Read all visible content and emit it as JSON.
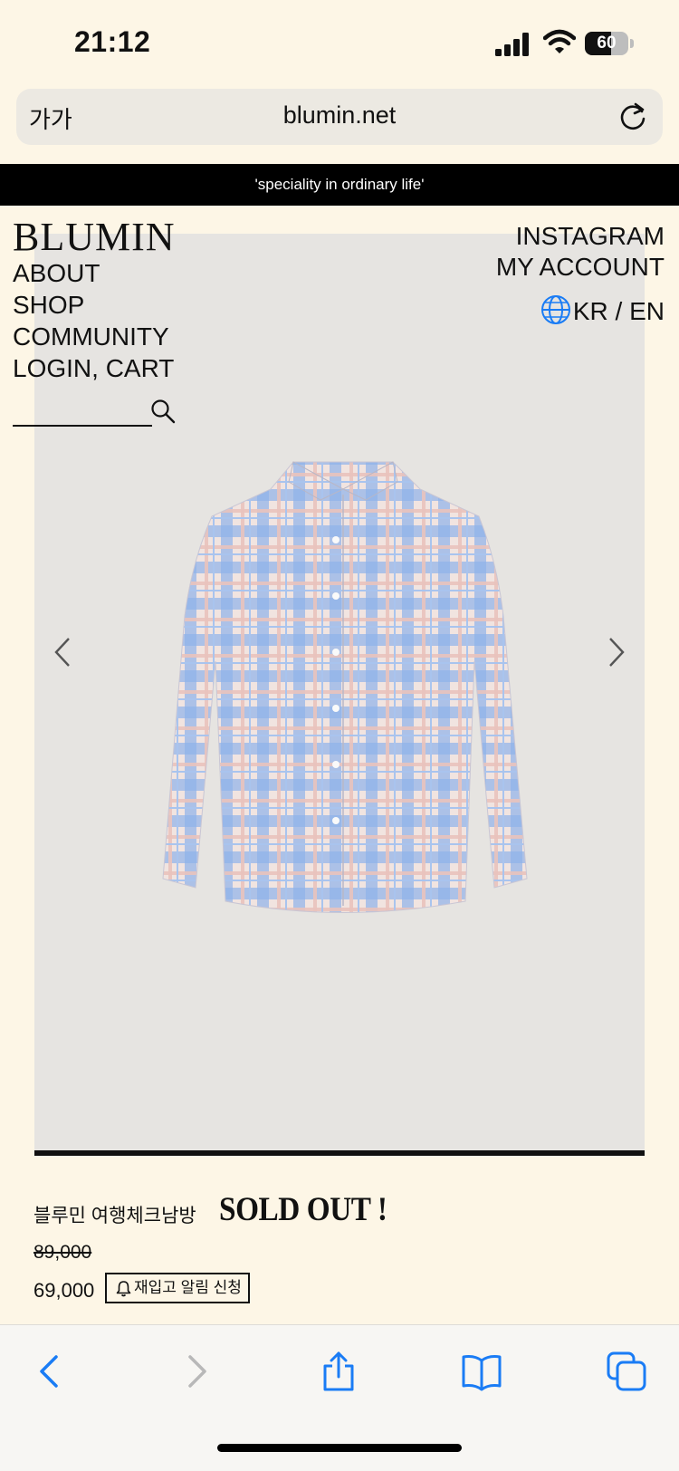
{
  "status_bar": {
    "time": "21:12",
    "battery_level": "60",
    "battery_fraction": 0.6
  },
  "browser": {
    "text_size_button": "가가",
    "url": "blumin.net"
  },
  "announcement": "'speciality in ordinary life'",
  "header": {
    "logo": "BLUMIN",
    "nav_left": [
      "ABOUT",
      "SHOP",
      "COMMUNITY",
      "LOGIN, CART"
    ],
    "nav_right": [
      "INSTAGRAM",
      "MY ACCOUNT"
    ],
    "language": "KR / EN"
  },
  "product": {
    "name": "블루민 여행체크남방",
    "status": "SOLD OUT !",
    "original_price": "89,000",
    "sale_price": "69,000",
    "restock_button": "재입고 알림 신청"
  },
  "colors": {
    "background": "#fdf6e6",
    "image_background": "#e6e4e1",
    "accent_blue": "#1a7cf5",
    "shirt_blue": "#8fb3ea",
    "shirt_pink": "#e9cfc8"
  },
  "icons": {
    "reload": "reload-icon",
    "search": "search-icon",
    "globe": "globe-icon",
    "bell": "bell-icon",
    "toolbar": [
      "back-icon",
      "forward-icon",
      "share-icon",
      "bookmarks-icon",
      "tabs-icon"
    ]
  }
}
